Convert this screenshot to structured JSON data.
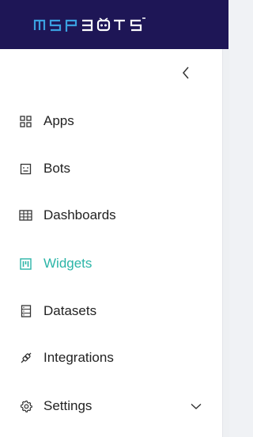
{
  "brand": {
    "logo_text": "MSPBOTS"
  },
  "sidebar": {
    "collapse_icon": "chevron-left-icon",
    "items": [
      {
        "label": "Apps",
        "icon": "apps-grid-icon",
        "active": false
      },
      {
        "label": "Bots",
        "icon": "bot-icon",
        "active": false
      },
      {
        "label": "Dashboards",
        "icon": "table-icon",
        "active": false
      },
      {
        "label": "Widgets",
        "icon": "widget-icon",
        "active": true
      },
      {
        "label": "Datasets",
        "icon": "dataset-icon",
        "active": false
      },
      {
        "label": "Integrations",
        "icon": "plug-icon",
        "active": false
      },
      {
        "label": "Settings",
        "icon": "gear-icon",
        "active": false,
        "expand_icon": "chevron-down-icon"
      }
    ]
  },
  "colors": {
    "topbar": "#1e1656",
    "active": "#2bb5a7",
    "text": "#222222"
  }
}
